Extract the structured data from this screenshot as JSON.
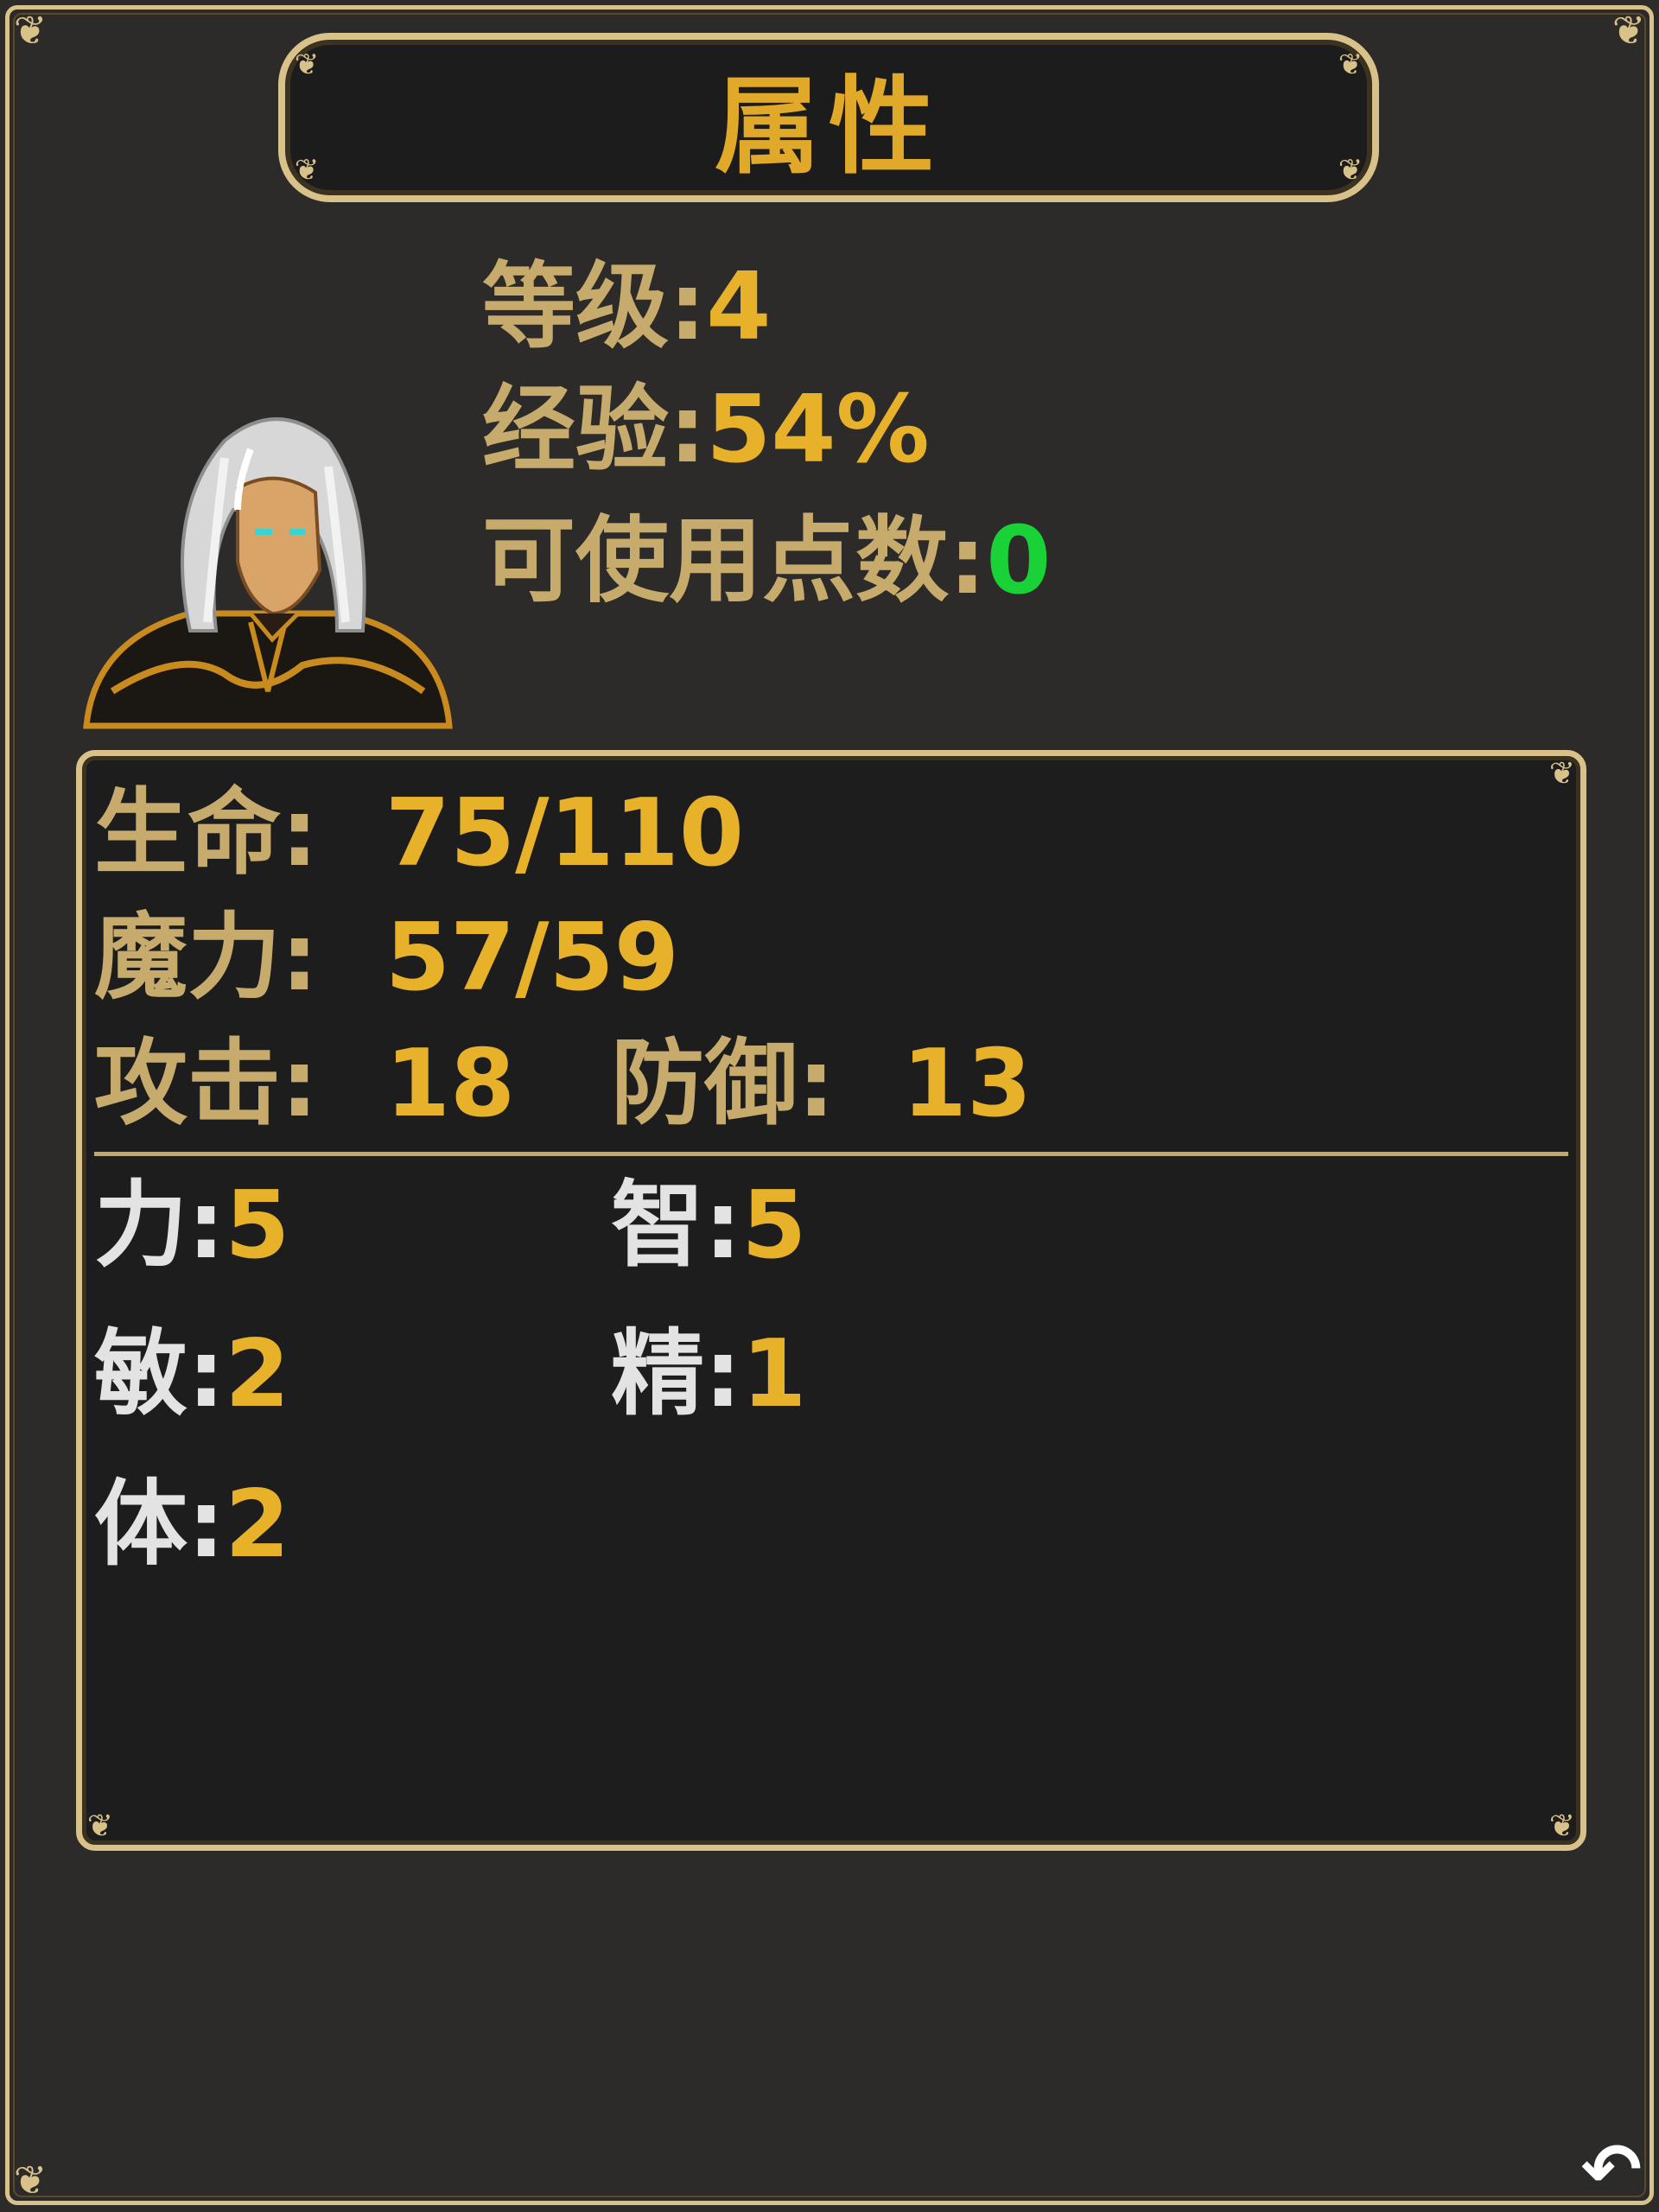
{
  "title": "属性",
  "hero": {
    "level_label": "等级:",
    "level_value": "4",
    "exp_label": "经验:",
    "exp_value": "54%",
    "points_label": "可使用点数:",
    "points_value": "0"
  },
  "combat": {
    "hp_label": "生命:",
    "hp_value": "75/110",
    "mp_label": "魔力:",
    "mp_value": "57/59",
    "atk_label": "攻击:",
    "atk_value": "18",
    "def_label": "防御:",
    "def_value": "13"
  },
  "attributes": {
    "str_label": "力:",
    "str_value": "5",
    "int_label": "智:",
    "int_value": "5",
    "agi_label": "敏:",
    "agi_value": "2",
    "spi_label": "精:",
    "spi_value": "1",
    "con_label": "体:",
    "con_value": "2"
  },
  "colors": {
    "frame": "#d9c28a",
    "label": "#c7ab6d",
    "value": "#e7b12a",
    "points_value": "#18d238",
    "attribute_label": "#e3e3e3"
  },
  "icons": {
    "back": "back-arrow-icon",
    "corner": "ornament-corner-icon"
  }
}
